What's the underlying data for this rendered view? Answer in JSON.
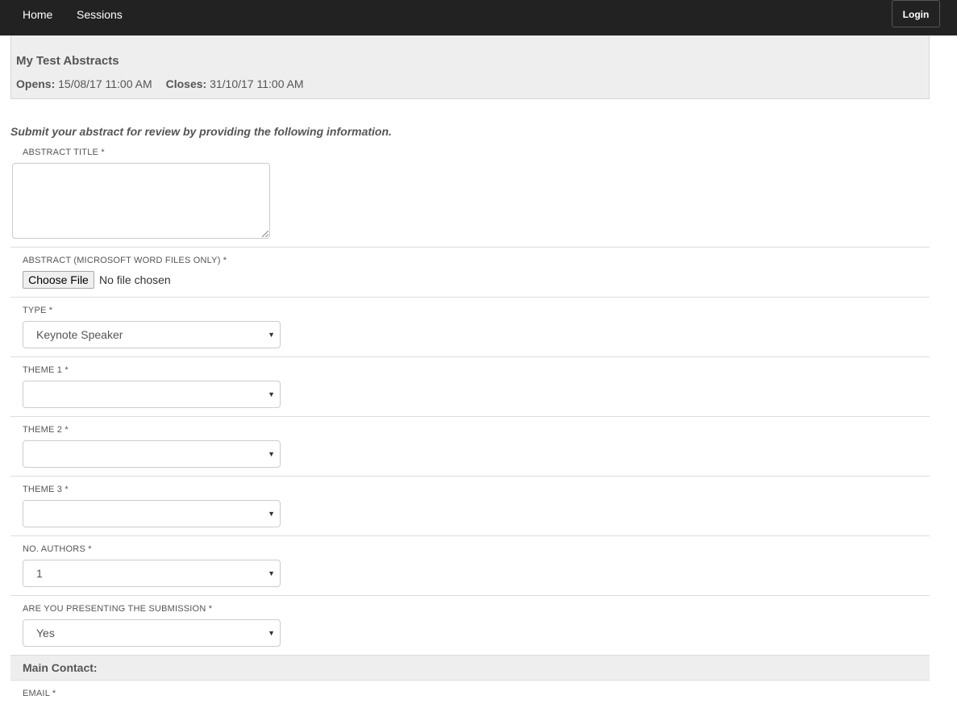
{
  "nav": {
    "home": "Home",
    "sessions": "Sessions",
    "login": "Login"
  },
  "header": {
    "title": "My Test Abstracts",
    "opens_label": "Opens:",
    "opens_value": "15/08/17 11:00 AM",
    "closes_label": "Closes:",
    "closes_value": "31/10/17 11:00 AM"
  },
  "form": {
    "intro": "Submit your abstract for review by providing the following information.",
    "abstract_title": {
      "label": "ABSTRACT TITLE *",
      "value": ""
    },
    "abstract_file": {
      "label": "ABSTRACT (MICROSOFT WORD FILES ONLY) *",
      "button": "Choose File",
      "status": "No file chosen"
    },
    "type": {
      "label": "TYPE *",
      "value": "Keynote Speaker"
    },
    "theme1": {
      "label": "THEME 1 *",
      "value": ""
    },
    "theme2": {
      "label": "THEME 2 *",
      "value": ""
    },
    "theme3": {
      "label": "THEME 3 *",
      "value": ""
    },
    "authors": {
      "label": "NO. AUTHORS *",
      "value": "1"
    },
    "presenting": {
      "label": "ARE YOU PRESENTING THE SUBMISSION *",
      "value": "Yes"
    },
    "main_contact": {
      "title": "Main Contact:"
    },
    "email": {
      "label": "EMAIL *"
    }
  },
  "colors": {
    "navbar": "#222222",
    "panel": "#eeeeee",
    "text": "#555555"
  },
  "icons": {
    "select_arrow": "caret-down-icon",
    "resize_grip": "resize-grip-icon"
  }
}
